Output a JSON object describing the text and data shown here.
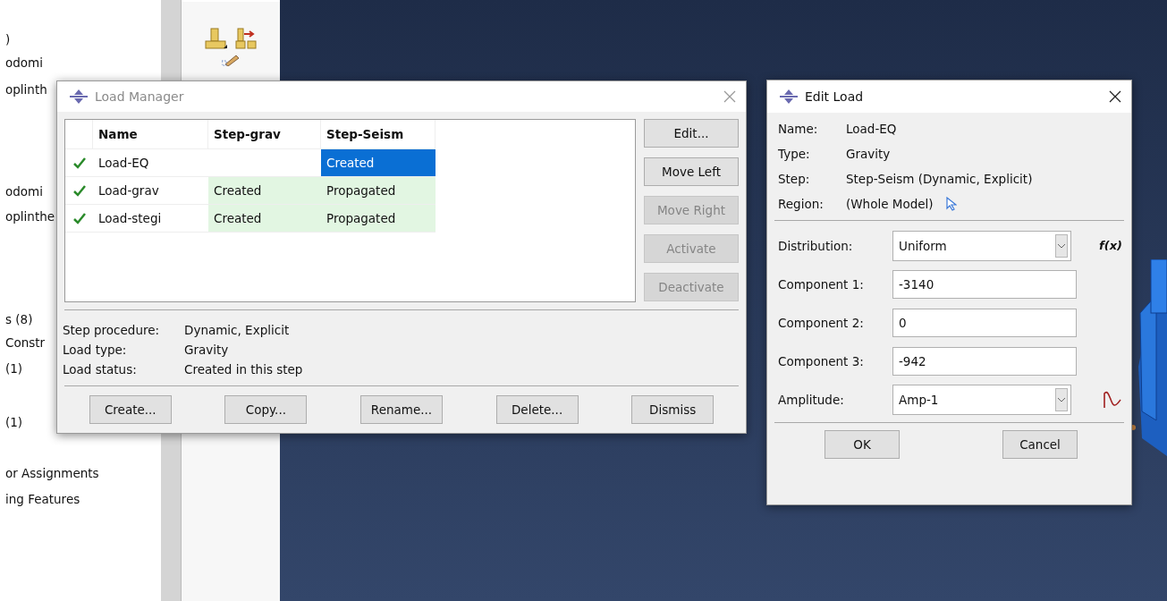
{
  "model_tree": {
    "items": [
      {
        "label": ")"
      },
      {
        "label": "odomi"
      },
      {
        "label": "oplinth"
      },
      {
        "label": "odomi"
      },
      {
        "label": "oplinthe"
      },
      {
        "label": "s (8)"
      },
      {
        "label": "Constr"
      },
      {
        "label": "(1)"
      },
      {
        "label": "(1)"
      },
      {
        "label": "or Assignments"
      },
      {
        "label": "ing Features"
      }
    ]
  },
  "load_manager": {
    "title": "Load Manager",
    "active": false,
    "table": {
      "columns": [
        "Name",
        "Step-grav",
        "Step-Seism"
      ],
      "rows": [
        {
          "active": true,
          "cells": [
            {
              "text": "Load-EQ",
              "selected": false
            },
            {
              "text": "",
              "selected": false
            },
            {
              "text": "Created",
              "selected": true
            }
          ]
        },
        {
          "active": true,
          "cells": [
            {
              "text": "Load-grav",
              "selected": false
            },
            {
              "text": "Created",
              "selected": false
            },
            {
              "text": "Propagated",
              "selected": false
            }
          ]
        },
        {
          "active": true,
          "cells": [
            {
              "text": "Load-stegi",
              "selected": false
            },
            {
              "text": "Created",
              "selected": false
            },
            {
              "text": "Propagated",
              "selected": false
            }
          ]
        }
      ]
    },
    "side_buttons": [
      {
        "label": "Edit...",
        "disabled": false
      },
      {
        "label": "Move Left",
        "disabled": false
      },
      {
        "label": "Move Right",
        "disabled": true
      },
      {
        "label": "Activate",
        "disabled": true
      },
      {
        "label": "Deactivate",
        "disabled": true
      }
    ],
    "info": [
      {
        "label": "Step procedure:",
        "value": "Dynamic, Explicit"
      },
      {
        "label": "Load type:",
        "value": "Gravity"
      },
      {
        "label": "Load status:",
        "value": "Created in this step"
      }
    ],
    "buttons": [
      "Create...",
      "Copy...",
      "Rename...",
      "Delete...",
      "Dismiss"
    ]
  },
  "edit_load": {
    "title": "Edit Load",
    "active": true,
    "info": [
      {
        "label": "Name:",
        "value": "Load-EQ",
        "kind": "text"
      },
      {
        "label": "Type:",
        "value": "Gravity",
        "kind": "text"
      },
      {
        "label": "Step:",
        "value": "Step-Seism (Dynamic, Explicit)",
        "kind": "text"
      },
      {
        "label": "Region:",
        "value": "(Whole Model)",
        "kind": "pick"
      }
    ],
    "fields": [
      {
        "label": "Distribution:",
        "value": "Uniform",
        "kind": "select",
        "button": "f(x)"
      },
      {
        "label": "Component 1:",
        "value": "-3140",
        "kind": "input"
      },
      {
        "label": "Component 2:",
        "value": "0",
        "kind": "input"
      },
      {
        "label": "Component 3:",
        "value": "-942",
        "kind": "input"
      },
      {
        "label": "Amplitude:",
        "value": "Amp-1",
        "kind": "select",
        "wave_icon": true
      }
    ],
    "buttons": [
      "OK",
      "Cancel"
    ]
  }
}
